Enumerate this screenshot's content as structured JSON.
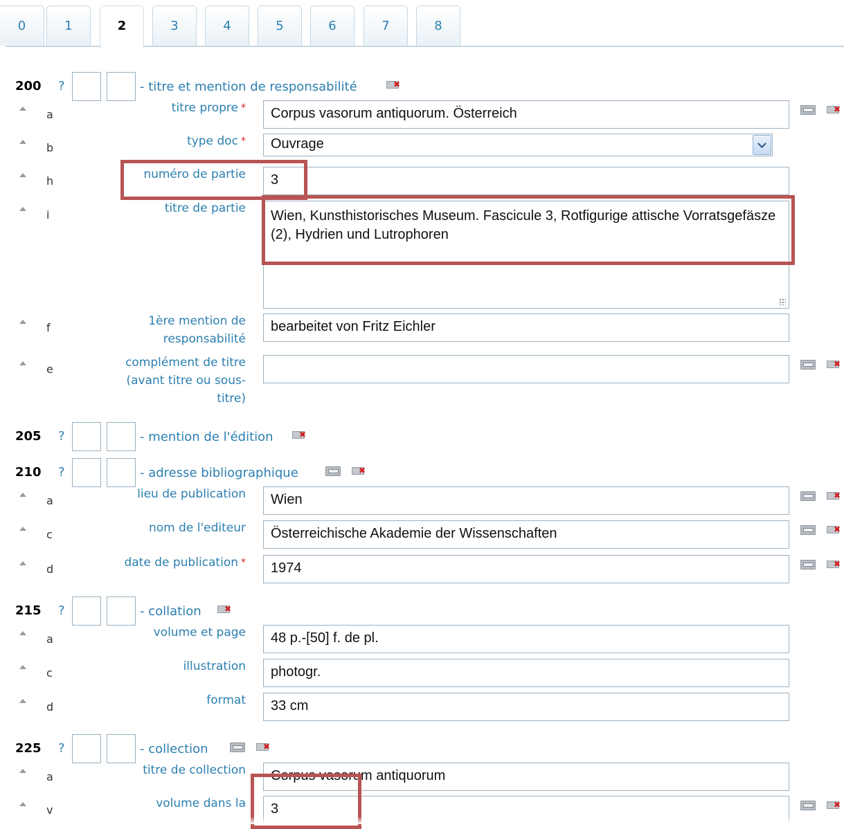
{
  "tabs": [
    {
      "label": "0"
    },
    {
      "label": "1"
    },
    {
      "label": "2"
    },
    {
      "label": "3"
    },
    {
      "label": "4"
    },
    {
      "label": "5"
    },
    {
      "label": "6"
    },
    {
      "label": "7"
    },
    {
      "label": "8"
    }
  ],
  "active_tab": "2",
  "help_mark": "?",
  "required_mark": "*",
  "fields": [
    {
      "tag": "200",
      "label": "- titre et mention de responsabilité",
      "subfields": [
        {
          "code": "a",
          "label": "titre propre",
          "value": "Corpus vasorum antiquorum. Österreich"
        },
        {
          "code": "b",
          "label": "type doc",
          "value": "Ouvrage"
        },
        {
          "code": "h",
          "label": "numéro de partie",
          "value": "3"
        },
        {
          "code": "i",
          "label": "titre de partie",
          "value": "Wien, Kunsthistorisches Museum. Fascicule 3, Rotfigurige attische Vorratsgefäsze (2), Hydrien und Lutrophoren"
        },
        {
          "code": "f",
          "label": "1ère mention de responsabilité",
          "value": "bearbeitet von Fritz Eichler"
        },
        {
          "code": "e",
          "label": "complément de titre (avant titre ou sous-titre)",
          "value": ""
        }
      ]
    },
    {
      "tag": "205",
      "label": "- mention de l'édition"
    },
    {
      "tag": "210",
      "label": "- adresse bibliographique",
      "subfields": [
        {
          "code": "a",
          "label": "lieu de publication",
          "value": "Wien"
        },
        {
          "code": "c",
          "label": "nom de l'editeur",
          "value": "Österreichische Akademie der Wissenschaften"
        },
        {
          "code": "d",
          "label": "date de publication",
          "value": "1974"
        }
      ]
    },
    {
      "tag": "215",
      "label": "- collation",
      "subfields": [
        {
          "code": "a",
          "label": "volume et page",
          "value": "48 p.-[50] f. de pl."
        },
        {
          "code": "c",
          "label": "illustration",
          "value": "photogr."
        },
        {
          "code": "d",
          "label": "format",
          "value": "33 cm"
        }
      ]
    },
    {
      "tag": "225",
      "label": "- collection",
      "subfields": [
        {
          "code": "a",
          "label": "titre de collection",
          "value": "Corpus vasorum antiquorum"
        },
        {
          "code": "v",
          "label": "volume dans la",
          "value": "3"
        }
      ]
    }
  ],
  "colors": {
    "link": "#2c7fb0",
    "required": "#d02020",
    "annotation_box": "#b85454"
  }
}
